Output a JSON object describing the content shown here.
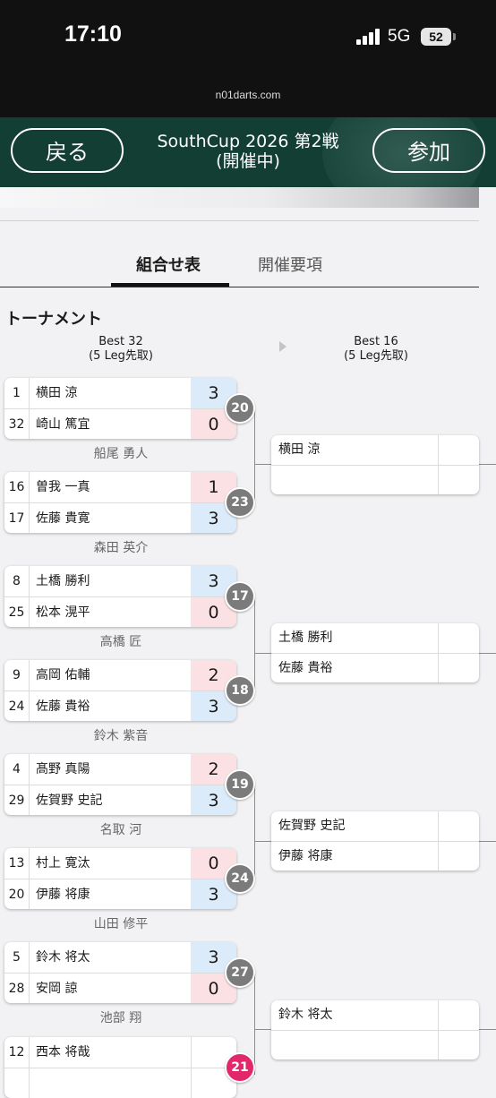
{
  "status": {
    "time": "17:10",
    "network": "5G",
    "battery": "52"
  },
  "browser": {
    "url": "n01darts.com"
  },
  "header": {
    "back_label": "戻る",
    "join_label": "参加",
    "title": "SouthCup 2026 第2戦",
    "subtitle": "(開催中)"
  },
  "tabs": [
    {
      "label": "組合せ表",
      "active": true
    },
    {
      "label": "開催要項",
      "active": false
    }
  ],
  "section_title": "トーナメント",
  "rounds": [
    {
      "name": "Best 32",
      "format": "(5 Leg先取)"
    },
    {
      "name": "Best 16",
      "format": "(5 Leg先取)"
    }
  ],
  "matches": [
    {
      "p1": {
        "seed": "1",
        "name": "横田 涼",
        "score": "3",
        "result": "win"
      },
      "p2": {
        "seed": "32",
        "name": "崎山 篤宜",
        "score": "0",
        "result": "lose"
      },
      "match_no": "20",
      "referee": "船尾 勇人"
    },
    {
      "p1": {
        "seed": "16",
        "name": "曽我 一真",
        "score": "1",
        "result": "lose"
      },
      "p2": {
        "seed": "17",
        "name": "佐藤 貴寛",
        "score": "3",
        "result": "win"
      },
      "match_no": "23",
      "referee": "森田 英介"
    },
    {
      "p1": {
        "seed": "8",
        "name": "土橋 勝利",
        "score": "3",
        "result": "win"
      },
      "p2": {
        "seed": "25",
        "name": "松本 滉平",
        "score": "0",
        "result": "lose"
      },
      "match_no": "17",
      "referee": "高橋 匠"
    },
    {
      "p1": {
        "seed": "9",
        "name": "高岡 佑輔",
        "score": "2",
        "result": "lose"
      },
      "p2": {
        "seed": "24",
        "name": "佐藤 貴裕",
        "score": "3",
        "result": "win"
      },
      "match_no": "18",
      "referee": "鈴木 紫音"
    },
    {
      "p1": {
        "seed": "4",
        "name": "髙野 真陽",
        "score": "2",
        "result": "lose"
      },
      "p2": {
        "seed": "29",
        "name": "佐賀野 史記",
        "score": "3",
        "result": "win"
      },
      "match_no": "19",
      "referee": "名取 河"
    },
    {
      "p1": {
        "seed": "13",
        "name": "村上 寛汰",
        "score": "0",
        "result": "lose"
      },
      "p2": {
        "seed": "20",
        "name": "伊藤 将康",
        "score": "3",
        "result": "win"
      },
      "match_no": "24",
      "referee": "山田 修平"
    },
    {
      "p1": {
        "seed": "5",
        "name": "鈴木 将太",
        "score": "3",
        "result": "win"
      },
      "p2": {
        "seed": "28",
        "name": "安岡 諒",
        "score": "0",
        "result": "lose"
      },
      "match_no": "27",
      "referee": "池部 翔"
    },
    {
      "p1": {
        "seed": "12",
        "name": "西本 将哉",
        "score": "",
        "result": "none"
      },
      "p2": {
        "seed": "",
        "name": "",
        "score": "",
        "result": "none"
      },
      "match_no": "21",
      "referee": ""
    }
  ],
  "round2": [
    {
      "p1": "横田 涼",
      "p2": ""
    },
    {
      "p1": "土橋 勝利",
      "p2": "佐藤 貴裕"
    },
    {
      "p1": "佐賀野 史記",
      "p2": "伊藤 将康"
    },
    {
      "p1": "鈴木 将太",
      "p2": ""
    }
  ],
  "colors": {
    "header_bg": "#123e33",
    "win_bg": "#dcebfa",
    "lose_bg": "#fbe1e3",
    "match_badge": "#7b7b7b",
    "live_badge": "#e2286a"
  }
}
